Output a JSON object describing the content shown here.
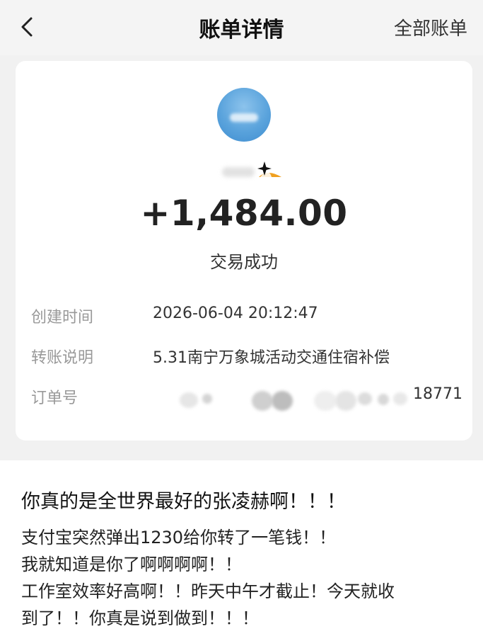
{
  "navbar": {
    "back_icon": "chevron-left-icon",
    "title": "账单详情",
    "right_link": "全部账单"
  },
  "bill": {
    "avatar_icon": "avatar-sky-image",
    "name_badge_icon": "star-badge-icon",
    "amount": "+1,484.00",
    "status": "交易成功",
    "rows": [
      {
        "label": "创建时间",
        "value": "2026-06-04 20:12:47"
      },
      {
        "label": "转账说明",
        "value": "5.31南宁万象城活动交通住宿补偿"
      },
      {
        "label": "订单号",
        "value": "18771"
      }
    ]
  },
  "post": {
    "title": "你真的是全世界最好的张凌赫啊！！！",
    "lines": [
      "支付宝突然弹出1230给你转了一笔钱！！",
      "我就知道是你了啊啊啊啊！！",
      "工作室效率好高啊！！昨天中午才截止！今天就收",
      "到了！！你真是说到做到！！！"
    ]
  },
  "colors": {
    "background": "#f1f1f1",
    "card": "#ffffff",
    "label_gray": "#999999",
    "text_dark": "#222222"
  }
}
